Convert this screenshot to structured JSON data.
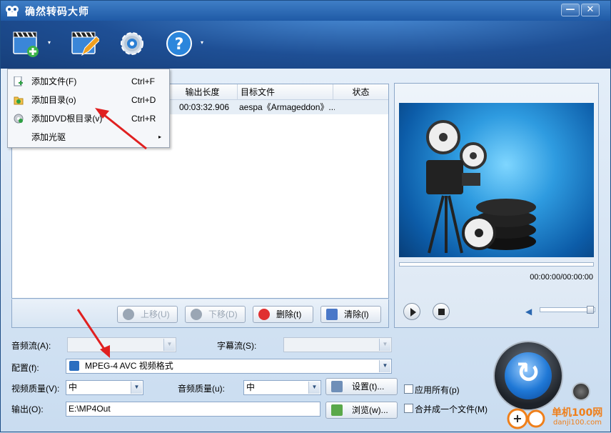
{
  "window": {
    "title": "确然转码大师",
    "minimize_label": "—",
    "close_label": "✕"
  },
  "toolbar": {
    "buttons": [
      {
        "name": "add-file-button",
        "icon": "film-plus-icon"
      },
      {
        "name": "edit-button",
        "icon": "film-pencil-icon"
      },
      {
        "name": "settings-button",
        "icon": "gear-icon"
      },
      {
        "name": "help-button",
        "icon": "help-icon",
        "label": "?"
      }
    ],
    "dropdown_glyph": "▾"
  },
  "file_list": {
    "columns": [
      "输出长度",
      "目标文件",
      "状态"
    ],
    "rows": [
      {
        "duration": "00:03:32.906",
        "target": "aespa《Armageddon》...",
        "status": ""
      }
    ]
  },
  "list_buttons": {
    "move_up": "上移(U)",
    "move_down": "下移(D)",
    "delete": "删除(t)",
    "clear": "清除(l)"
  },
  "preview": {
    "timecode": "00:00:00/00:00:00",
    "volume_level": 0.85
  },
  "form": {
    "audio_stream_label": "音频流(A):",
    "subtitle_stream_label": "字幕流(S):",
    "profile_label": "配置(f):",
    "profile_value": "MPEG-4 AVC 视频格式",
    "video_quality_label": "视频质量(V):",
    "video_quality_value": "中",
    "audio_quality_label": "音频质量(u):",
    "audio_quality_value": "中",
    "settings_button": "设置(t)...",
    "apply_all_label": "应用所有(p)",
    "output_label": "输出(O):",
    "output_value": "E:\\MP4Out",
    "browse_button": "浏览(w)...",
    "merge_label": "合并成一个文件(M)"
  },
  "menu": {
    "items": [
      {
        "label": "添加文件(F)",
        "shortcut": "Ctrl+F",
        "icon": "add-file-icon"
      },
      {
        "label": "添加目录(o)",
        "shortcut": "Ctrl+D",
        "icon": "add-folder-icon"
      },
      {
        "label": "添加DVD根目录(v)",
        "shortcut": "Ctrl+R",
        "icon": "dvd-icon"
      },
      {
        "label": "添加光驱",
        "shortcut": "",
        "submenu_glyph": "▸"
      }
    ]
  },
  "watermark": {
    "text": "单机100网",
    "subtext": "danji100.com"
  },
  "colors": {
    "annotation_arrow": "#e02020",
    "titlebar": "#2a66b0"
  }
}
